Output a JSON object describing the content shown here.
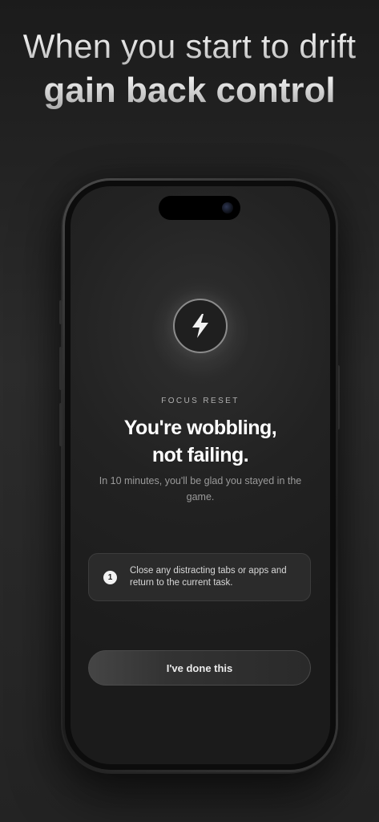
{
  "headline": {
    "line1": "When you start to drift",
    "line2": "gain back control"
  },
  "screen": {
    "icon": "lightning-bolt-icon",
    "eyebrow": "FOCUS RESET",
    "title_line1": "You're wobbling,",
    "title_line2": "not failing.",
    "subtitle": "In 10 minutes, you'll be glad you stayed in the game.",
    "steps": [
      {
        "number": "1",
        "text": "Close any distracting tabs or apps and return to the current task."
      }
    ],
    "cta_label": "I've done this"
  },
  "colors": {
    "background": "#262626",
    "screen_bg": "#1f1f1f",
    "text_primary": "#ffffff",
    "text_secondary": "#9a9a9a"
  }
}
